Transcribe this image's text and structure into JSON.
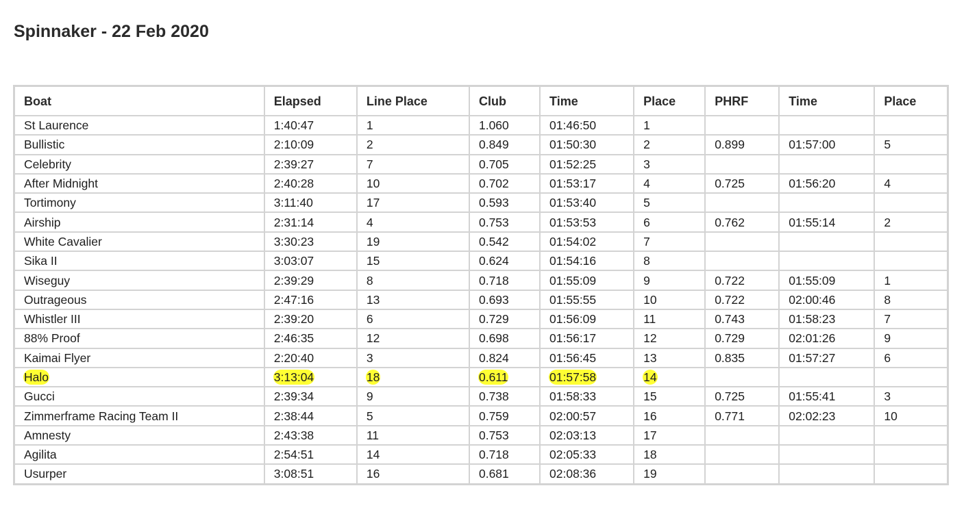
{
  "page": {
    "title": "Spinnaker - 22 Feb 2020"
  },
  "highlight_color": "#ffff33",
  "table": {
    "headers": [
      "Boat",
      "Elapsed",
      "Line Place",
      "Club",
      "Time",
      "Place",
      "PHRF",
      "Time",
      "Place"
    ],
    "rows": [
      [
        "St Laurence",
        "1:40:47",
        "1",
        "1.060",
        "01:46:50",
        "1",
        "",
        "",
        ""
      ],
      [
        "Bullistic",
        "2:10:09",
        "2",
        "0.849",
        "01:50:30",
        "2",
        "0.899",
        "01:57:00",
        "5"
      ],
      [
        "Celebrity",
        "2:39:27",
        "7",
        "0.705",
        "01:52:25",
        "3",
        "",
        "",
        ""
      ],
      [
        "After Midnight",
        "2:40:28",
        "10",
        "0.702",
        "01:53:17",
        "4",
        "0.725",
        "01:56:20",
        "4"
      ],
      [
        "Tortimony",
        "3:11:40",
        "17",
        "0.593",
        "01:53:40",
        "5",
        "",
        "",
        ""
      ],
      [
        "Airship",
        "2:31:14",
        "4",
        "0.753",
        "01:53:53",
        "6",
        "0.762",
        "01:55:14",
        "2"
      ],
      [
        "White Cavalier",
        "3:30:23",
        "19",
        "0.542",
        "01:54:02",
        "7",
        "",
        "",
        ""
      ],
      [
        "Sika II",
        "3:03:07",
        "15",
        "0.624",
        "01:54:16",
        "8",
        "",
        "",
        ""
      ],
      [
        "Wiseguy",
        "2:39:29",
        "8",
        "0.718",
        "01:55:09",
        "9",
        "0.722",
        "01:55:09",
        "1"
      ],
      [
        "Outrageous",
        "2:47:16",
        "13",
        "0.693",
        "01:55:55",
        "10",
        "0.722",
        "02:00:46",
        "8"
      ],
      [
        "Whistler III",
        "2:39:20",
        "6",
        "0.729",
        "01:56:09",
        "11",
        "0.743",
        "01:58:23",
        "7"
      ],
      [
        "88% Proof",
        "2:46:35",
        "12",
        "0.698",
        "01:56:17",
        "12",
        "0.729",
        "02:01:26",
        "9"
      ],
      [
        "Kaimai Flyer",
        "2:20:40",
        "3",
        "0.824",
        "01:56:45",
        "13",
        "0.835",
        "01:57:27",
        "6"
      ],
      [
        "Halo",
        "3:13:04",
        "18",
        "0.611",
        "01:57:58",
        "14",
        "",
        "",
        ""
      ],
      [
        "Gucci",
        "2:39:34",
        "9",
        "0.738",
        "01:58:33",
        "15",
        "0.725",
        "01:55:41",
        "3"
      ],
      [
        "Zimmerframe Racing Team II",
        "2:38:44",
        "5",
        "0.759",
        "02:00:57",
        "16",
        "0.771",
        "02:02:23",
        "10"
      ],
      [
        "Amnesty",
        "2:43:38",
        "11",
        "0.753",
        "02:03:13",
        "17",
        "",
        "",
        ""
      ],
      [
        "Agilita",
        "2:54:51",
        "14",
        "0.718",
        "02:05:33",
        "18",
        "",
        "",
        ""
      ],
      [
        "Usurper",
        "3:08:51",
        "16",
        "0.681",
        "02:08:36",
        "19",
        "",
        "",
        ""
      ]
    ],
    "highlighted_row_boat": "Halo"
  }
}
